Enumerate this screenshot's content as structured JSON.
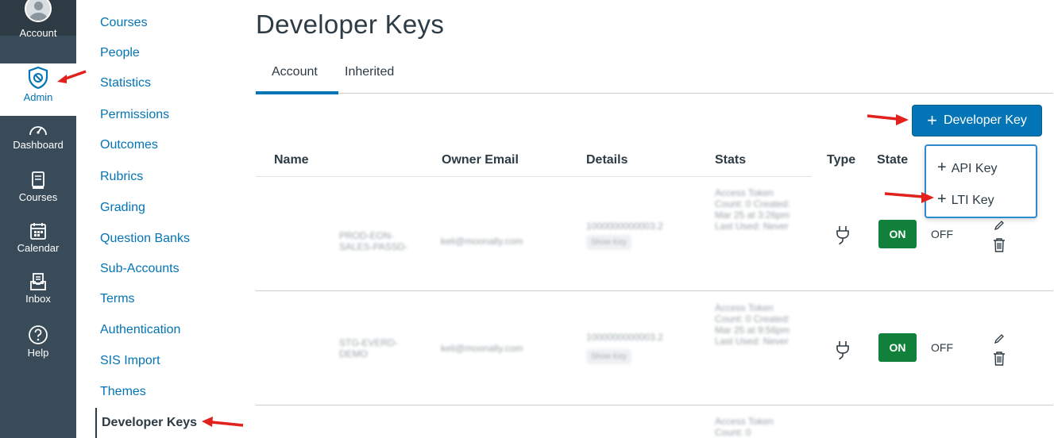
{
  "global_nav": {
    "account_label": "Account",
    "admin_label": "Admin",
    "dashboard_label": "Dashboard",
    "courses_label": "Courses",
    "calendar_label": "Calendar",
    "inbox_label": "Inbox",
    "help_label": "Help"
  },
  "sub_nav": {
    "items": [
      "Courses",
      "People",
      "Statistics",
      "Permissions",
      "Outcomes",
      "Rubrics",
      "Grading",
      "Question Banks",
      "Sub-Accounts",
      "Terms",
      "Authentication",
      "SIS Import",
      "Themes",
      "Developer Keys"
    ],
    "active": "Developer Keys"
  },
  "page": {
    "title": "Developer Keys",
    "tabs": [
      "Account",
      "Inherited"
    ],
    "active_tab": "Account",
    "add_button_label": "Developer Key"
  },
  "table": {
    "columns": [
      "Name",
      "Owner Email",
      "Details",
      "Stats",
      "Type",
      "State"
    ],
    "rows": [
      {
        "name": "PROD-EON-SALES-PASSD-",
        "email": "keli@moonally.com",
        "details_id": "1000000000003.2",
        "details_badge": "Show Key",
        "stats": "Access Token Count: 0 Created: Mar 25 at 3:26pm Last Used: Never",
        "state_on": "ON",
        "state_off": "OFF"
      },
      {
        "name": "STG-EVERD-DEMO",
        "email": "keli@moonally.com",
        "details_id": "1000000000003.2",
        "details_badge": "Show Key",
        "stats": "Access Token Count: 0 Created: Mar 25 at 9:56pm Last Used: Never",
        "state_on": "ON",
        "state_off": "OFF"
      },
      {
        "stats": "Access Token Count: 0"
      }
    ]
  },
  "dropdown": {
    "items": [
      "API Key",
      "LTI Key"
    ]
  },
  "colors": {
    "nav_bg": "#394b58",
    "brand_blue": "#0374b5",
    "toggle_green": "#11803a",
    "annotation_red": "#e3211c"
  }
}
